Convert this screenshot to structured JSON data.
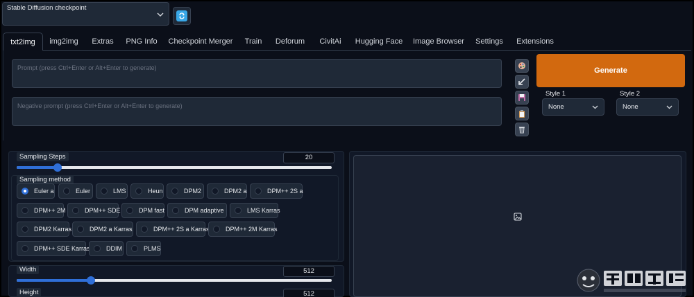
{
  "checkpoint": {
    "label": "Stable Diffusion checkpoint",
    "value": ""
  },
  "tabs": [
    {
      "label": "txt2img"
    },
    {
      "label": "img2img"
    },
    {
      "label": "Extras"
    },
    {
      "label": "PNG Info"
    },
    {
      "label": "Checkpoint Merger"
    },
    {
      "label": "Train"
    },
    {
      "label": "Deforum"
    },
    {
      "label": "CivitAi"
    },
    {
      "label": "Hugging Face"
    },
    {
      "label": "Image Browser"
    },
    {
      "label": "Settings"
    },
    {
      "label": "Extensions"
    }
  ],
  "prompt": {
    "placeholder": "Prompt (press Ctrl+Enter or Alt+Enter to generate)"
  },
  "negative_prompt": {
    "placeholder": "Negative prompt (press Ctrl+Enter or Alt+Enter to generate)"
  },
  "generate": {
    "label": "Generate"
  },
  "styles": [
    {
      "label": "Style 1",
      "value": "None"
    },
    {
      "label": "Style 2",
      "value": "None"
    }
  ],
  "sampling_steps": {
    "label": "Sampling Steps",
    "value": "20",
    "fraction": 0.13
  },
  "sampling_method": {
    "label": "Sampling method",
    "selected": "Euler a",
    "options": [
      "Euler a",
      "Euler",
      "LMS",
      "Heun",
      "DPM2",
      "DPM2 a",
      "DPM++ 2S a",
      "DPM++ 2M",
      "DPM++ SDE",
      "DPM fast",
      "DPM adaptive",
      "LMS Karras",
      "DPM2 Karras",
      "DPM2 a Karras",
      "DPM++ 2S a Karras",
      "DPM++ 2M Karras",
      "DPM++ SDE Karras",
      "DDIM",
      "PLMS"
    ]
  },
  "width": {
    "label": "Width",
    "value": "512",
    "fraction": 0.235
  },
  "height": {
    "label": "Height",
    "value": "512"
  },
  "colors": {
    "accent": "#2f6fd8",
    "generate": "#d2690f",
    "refresh": "#38a7e6"
  }
}
